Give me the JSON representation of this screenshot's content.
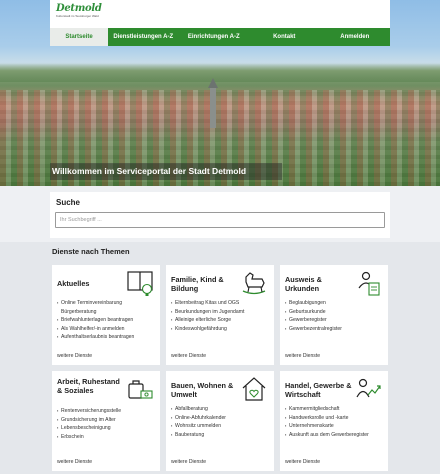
{
  "header": {
    "logo_text": "Detmold",
    "logo_subtext": "Kulturstadt im Teutoburger Wald",
    "nav": [
      {
        "label": "Startseite",
        "active": true
      },
      {
        "label": "Dienstleistungen A-Z",
        "active": false
      },
      {
        "label": "Einrichtungen A-Z",
        "active": false
      },
      {
        "label": "Kontakt",
        "active": false
      },
      {
        "label": "Anmelden",
        "active": false
      }
    ],
    "hero_title": "Willkommen im Serviceportal der Stadt Detmold"
  },
  "search": {
    "label": "Suche",
    "placeholder": "Ihr Suchbegriff ..."
  },
  "themes": {
    "title": "Dienste nach Themen",
    "more_label": "weitere Dienste",
    "cards": [
      {
        "title": "Aktuelles",
        "icon": "book-lightbulb-icon",
        "items": [
          "Online Terminvereinbarung Bürgerberatung",
          "Briefwahlunterlagen beantragen",
          "Als Wahlhelfer/-in anmelden",
          "Aufenthaltserlaubnis beantragen"
        ]
      },
      {
        "title": "Familie, Kind & Bildung",
        "icon": "rocking-horse-icon",
        "items": [
          "Elternbeitrag Kitas und OGS",
          "Beurkundungen im Jugendamt",
          "Alleinige elterliche Sorge",
          "Kindeswohlgefährdung"
        ]
      },
      {
        "title": "Ausweis & Urkunden",
        "icon": "id-document-icon",
        "items": [
          "Beglaubigungen",
          "Geburtsurkunde",
          "Gewerberegister",
          "Gewerbezentralregister"
        ]
      },
      {
        "title": "Arbeit, Ruhestand & Soziales",
        "icon": "handbag-money-icon",
        "items": [
          "Rentenversicherungsstelle",
          "Grundsicherung im Alter",
          "Lebensbescheinigung",
          "Erbschein"
        ]
      },
      {
        "title": "Bauen, Wohnen & Umwelt",
        "icon": "house-heart-icon",
        "items": [
          "Abfallberatung",
          "Online-Abfuhrkalender",
          "Wohnsitz ummelden",
          "Bauberatung"
        ]
      },
      {
        "title": "Handel, Gewerbe & Wirtschaft",
        "icon": "business-growth-icon",
        "items": [
          "Kammermitgliedschaft",
          "Handwerksrolle und -karte",
          "Unternehmenskarte",
          "Auskunft aus dem Gewerberegister"
        ]
      }
    ]
  },
  "colors": {
    "brand_green": "#2e8b2e",
    "page_background": "#e4e7eb"
  }
}
